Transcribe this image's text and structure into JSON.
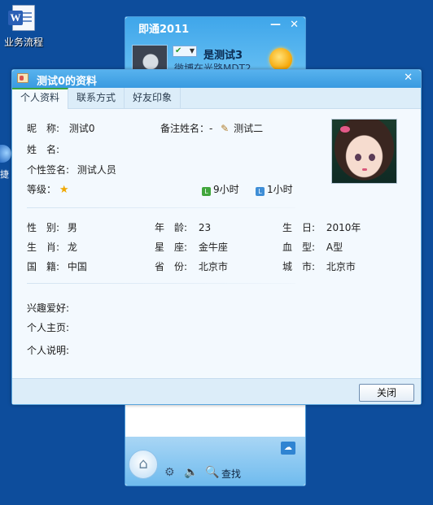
{
  "desktop": {
    "icon_label": "业务流程",
    "icon2_label": "捷"
  },
  "im": {
    "title": "即通2011",
    "minimize": "—",
    "close": "✕",
    "status_icon": "✔",
    "nickname": "是测试3",
    "signature": "微博在光路MDT2",
    "find_label": "查找",
    "home_icon": "⌂",
    "gear_icon": "⚙",
    "volume_icon": "🔈",
    "find_icon": "🔍",
    "cloud_icon": "☁"
  },
  "dialog": {
    "title": "测试0的资料",
    "close": "✕",
    "tabs": [
      "个人资料",
      "联系方式",
      "好友印象"
    ],
    "nickname_label": "昵　称:",
    "nickname": "测试0",
    "remark_label": "备注姓名：-",
    "remark": "测试二",
    "name_label": "姓　名:",
    "name": "",
    "signature_label": "个性签名:",
    "signature": "测试人员",
    "level_label": "等级：",
    "level_icon": "★",
    "online_time_1": "9小时",
    "online_time_2": "1小时",
    "details": [
      [
        {
          "label": "性　别:",
          "value": "男"
        },
        {
          "label": "年　龄:",
          "value": "23"
        },
        {
          "label": "生　日:",
          "value": "2010年"
        }
      ],
      [
        {
          "label": "生　肖:",
          "value": "龙"
        },
        {
          "label": "星　座:",
          "value": "金牛座"
        },
        {
          "label": "血　型:",
          "value": "A型"
        }
      ],
      [
        {
          "label": "国　籍:",
          "value": "中国"
        },
        {
          "label": "省　份:",
          "value": "北京市"
        },
        {
          "label": "城　市:",
          "value": "北京市"
        }
      ]
    ],
    "hobby_label": "兴趣爱好:",
    "homepage_label": "个人主页:",
    "description_label": "个人说明:",
    "close_button": "关闭"
  },
  "colors": {
    "desktop": "#0d4d9c",
    "accent": "#399ae0",
    "tab_active": "#3ea63e"
  }
}
